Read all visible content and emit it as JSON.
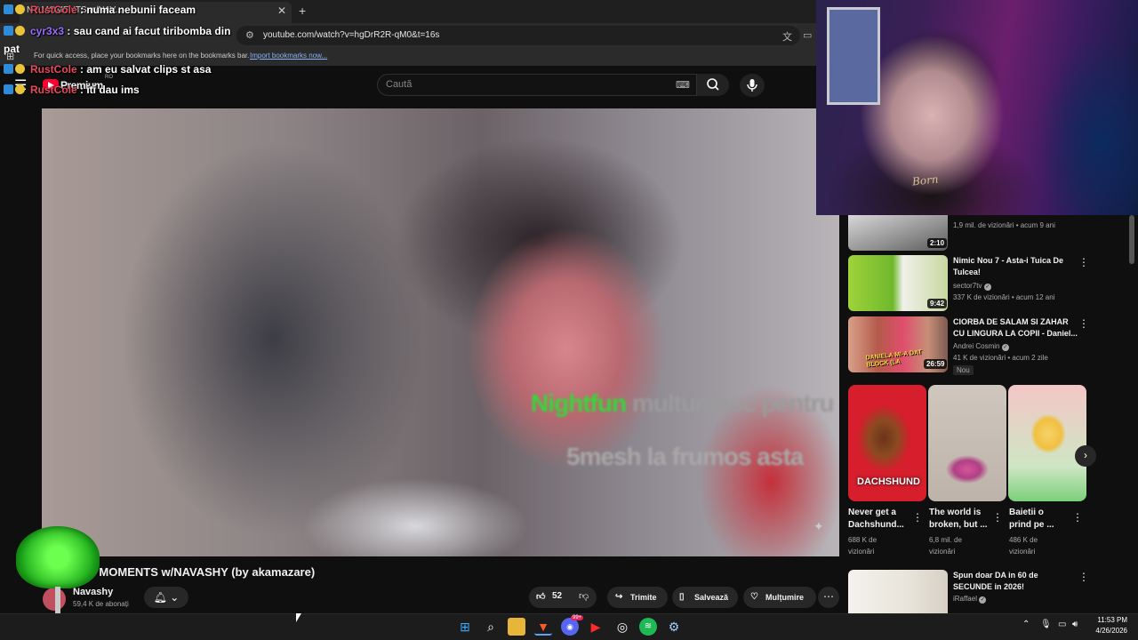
{
  "browser": {
    "tab_title": "NY MOMENTS w/NAV...",
    "url": "youtube.com/watch?v=hgDrR2R-qM0&t=16s",
    "bookmarks_hint": "For quick access, place your bookmarks here on the bookmarks bar.",
    "bookmarks_link": "Import bookmarks now...",
    "new_tab_icon": "plus-icon",
    "close_icon": "close-icon"
  },
  "youtube": {
    "logo_text": "Premium",
    "country": "RO",
    "search_placeholder": "Caută"
  },
  "chat": [
    {
      "user": "RustCole",
      "message": ": numa nebunii faceam"
    },
    {
      "user": "cyr3x3",
      "message": ": sau cand ai facut tiribomba din"
    },
    {
      "continuation": "pat"
    },
    {
      "user": "RustCole",
      "message": ": am eu salvat clips st asa"
    },
    {
      "user": "RustCole",
      "message": ": iti dau ims"
    }
  ],
  "video": {
    "overlay_line1_highlight": "Nightfun",
    "overlay_line1_rest": " multumesc pentru",
    "overlay_line2": "5mesh la frumos asta",
    "title": "NY MOMENTS w/NAVASHY (by akamazare)",
    "channel": "Navashy",
    "subscribers": "59,4 K de abonați",
    "likes": "52",
    "share_label": "Trimite",
    "save_label": "Salvează",
    "thanks_label": "Mulțumire",
    "more_label": "⋯"
  },
  "webcam": {
    "shirt_text": "Born"
  },
  "sidebar": {
    "videos": [
      {
        "duration": "2:10",
        "title": "",
        "channel": "",
        "meta": "1,9 mil. de vizionări • acum 9 ani"
      },
      {
        "duration": "9:42",
        "title": "Nimic Nou 7 - Asta-i Tuica De Tulcea!",
        "channel": "sector7tv",
        "meta": "337 K de vizionări • acum 12 ani"
      },
      {
        "duration": "26:59",
        "title": "CIORBA DE SALAM SI ZAHAR CU LINGURA LA COPII - Daniel...",
        "channel": "Andrei Cosmin",
        "meta": "41 K de vizionări • acum 2 zile",
        "badge": "Nou",
        "thumb_text": "DANIELA MI-A DAT BLOCK (LA"
      },
      {
        "duration": "",
        "title": "Spun doar DA in 60 de SECUNDE in 2026!",
        "channel": "iRaffael",
        "meta": "8,1 K de vizionări • acum 3 ore"
      }
    ],
    "shorts": [
      {
        "title": "Never get a Dachshund...",
        "meta1": "688 K de",
        "meta2": "vizionări",
        "thumb_text": "DACHSHUND"
      },
      {
        "title": "The world is broken, but ...",
        "meta1": "6,8 mil. de",
        "meta2": "vizionări"
      },
      {
        "title": "Baietii o prind pe ...",
        "meta1": "486 K de",
        "meta2": "vizionări"
      }
    ]
  },
  "taskbar": {
    "time": "11:53 PM",
    "date": "4/26/2026",
    "discord_badge": "99+"
  },
  "colors": {
    "youtube_red": "#ff0033",
    "background": "#0f0f0f",
    "pill": "#272727",
    "chat_user": "#e64a5c",
    "overlay_green": "#38d63a"
  }
}
